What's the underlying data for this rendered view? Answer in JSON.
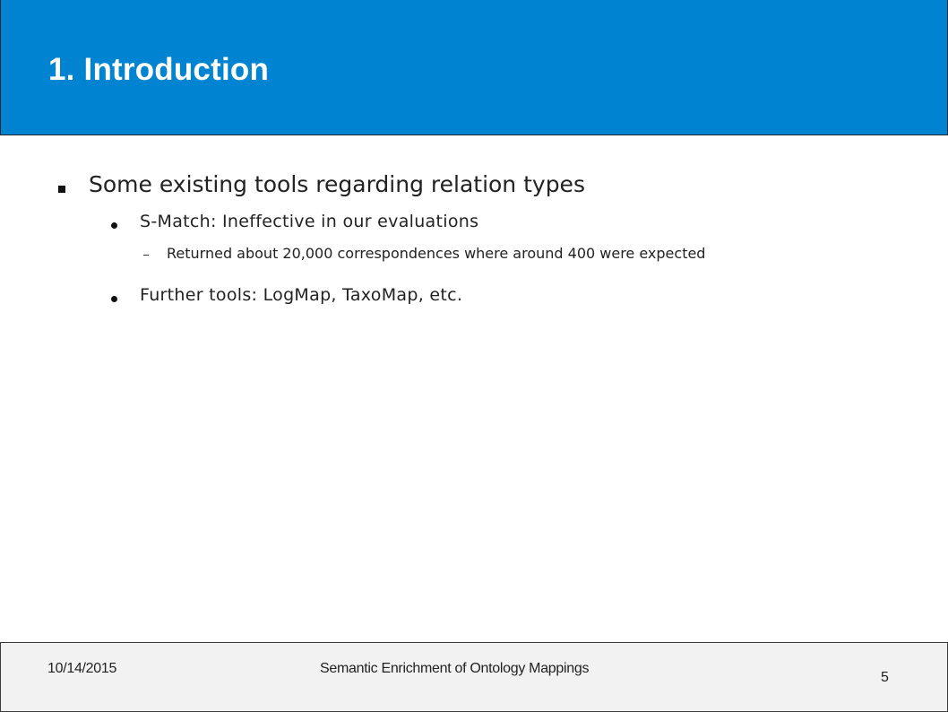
{
  "slide": {
    "title": "1. Introduction",
    "bullets": {
      "level1": "Some existing tools regarding relation types",
      "item1": "S-Match: Ineffective in our evaluations",
      "item1_sub": "Returned about 20,000 correspondences where around 400 were expected",
      "item2": "Further tools: LogMap, TaxoMap, etc."
    },
    "footer": {
      "date": "10/14/2015",
      "title": "Semantic Enrichment of Ontology Mappings",
      "page": "5"
    }
  },
  "colors": {
    "title_bar": "#0083d0",
    "title_text": "#ffffff",
    "body_text": "#222222",
    "footer_bg": "#f2f2f2"
  }
}
